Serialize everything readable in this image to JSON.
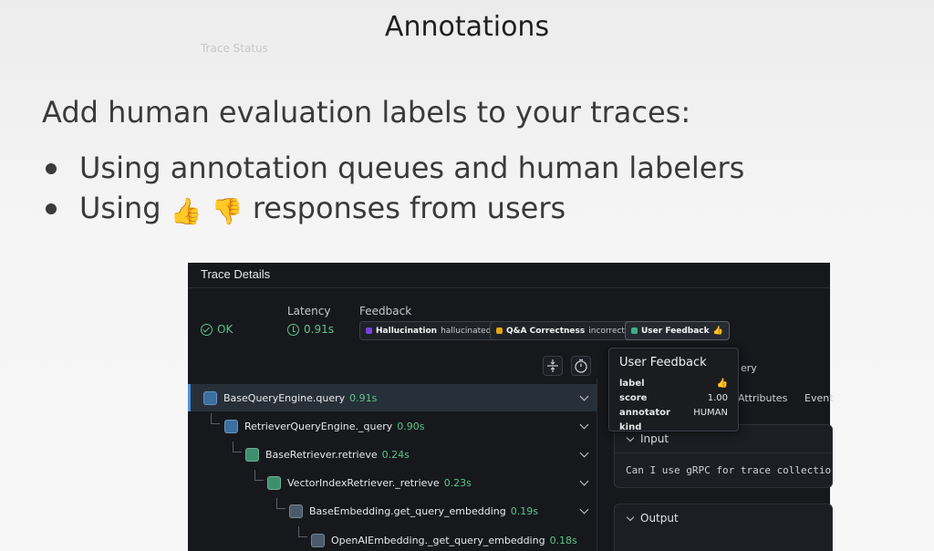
{
  "slide": {
    "title": "Annotations",
    "heading": "Add human evaluation labels to your traces:",
    "bullets": [
      {
        "text": "Using annotation queues and human labelers"
      },
      {
        "prefix": "Using",
        "suffix": "responses from users",
        "emoji_up": "👍",
        "emoji_down": "👎"
      }
    ]
  },
  "panel": {
    "title": "Trace Details",
    "trace_status_label": "Trace Status",
    "trace_status_value": "OK",
    "latency_label": "Latency",
    "latency_value": "0.91s",
    "feedback_label": "Feedback",
    "feedback_chips": [
      {
        "key": "Hallucination",
        "value": "hallucinated",
        "color": "#7b3fe4"
      },
      {
        "key": "Q&A Correctness",
        "value": "incorrect",
        "color": "#e8a317"
      },
      {
        "key": "User Feedback",
        "value": "👍",
        "color": "#3fae86"
      }
    ],
    "spans": [
      {
        "name": "BaseQueryEngine.query",
        "duration": "0.91s",
        "icon_color": "#3b6fa0"
      },
      {
        "name": "RetrieverQueryEngine._query",
        "duration": "0.90s",
        "icon_color": "#3b6fa0"
      },
      {
        "name": "BaseRetriever.retrieve",
        "duration": "0.24s",
        "icon_color": "#3e8f6e"
      },
      {
        "name": "VectorIndexRetriever._retrieve",
        "duration": "0.23s",
        "icon_color": "#3e8f6e"
      },
      {
        "name": "BaseEmbedding.get_query_embedding",
        "duration": "0.19s",
        "icon_color": "#4a5a6a"
      },
      {
        "name": "OpenAIEmbedding._get_query_embedding",
        "duration": "0.18s",
        "icon_color": "#4a5a6a"
      }
    ],
    "right": {
      "query_partial": "ery",
      "tab_attributes": "Attributes",
      "tab_events": "Event",
      "input_title": "Input",
      "input_text": "Can I use gRPC for trace collectio",
      "output_title": "Output"
    },
    "tooltip": {
      "title": "User Feedback",
      "rows": [
        {
          "k": "label",
          "v": "👍"
        },
        {
          "k": "score",
          "v": "1.00"
        },
        {
          "k": "annotator kind",
          "v": "HUMAN"
        }
      ]
    }
  }
}
